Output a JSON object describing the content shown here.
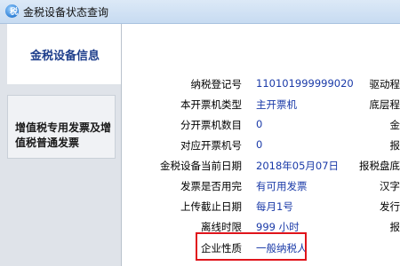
{
  "window": {
    "title": "金税设备状态查询"
  },
  "sidebar": {
    "header": "金税设备信息",
    "items": [
      {
        "label": "增值税专用发票及增值税普通发票"
      }
    ]
  },
  "fields": [
    {
      "label": "纳税登记号",
      "value": "110101999999020"
    },
    {
      "label": "本开票机类型",
      "value": "主开票机"
    },
    {
      "label": "分开票机数目",
      "value": "0"
    },
    {
      "label": "对应开票机号",
      "value": "0"
    },
    {
      "label": "金税设备当前日期",
      "value": "2018年05月07日"
    },
    {
      "label": "发票是否用完",
      "value": "有可用发票"
    },
    {
      "label": "上传截止日期",
      "value": "每月1号"
    },
    {
      "label": "离线时限",
      "value": "999 小时"
    },
    {
      "label": "企业性质",
      "value": "一般纳税人"
    }
  ],
  "right_column": [
    {
      "label": "驱动程"
    },
    {
      "label": "底层程"
    },
    {
      "label": "金"
    },
    {
      "label": "报"
    },
    {
      "label": "报税盘底"
    },
    {
      "label": "汉字"
    },
    {
      "label": "发行"
    },
    {
      "label": "报"
    }
  ]
}
